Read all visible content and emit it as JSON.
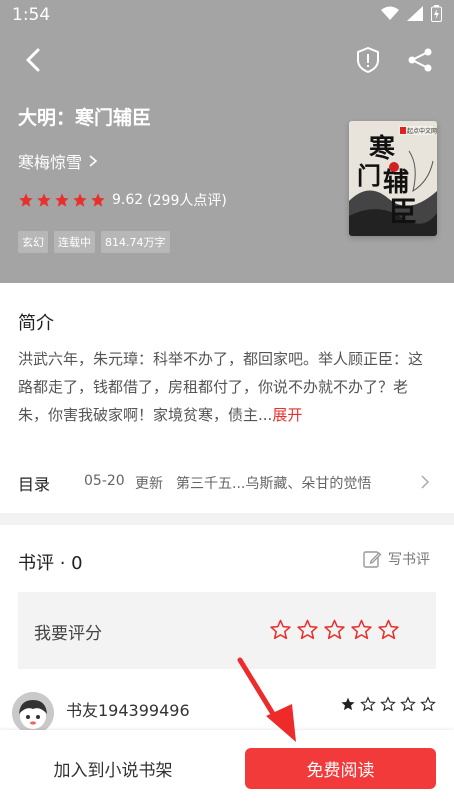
{
  "status": {
    "time": "1:54"
  },
  "book": {
    "title": "大明：寒门辅臣",
    "author": "寒梅惊雪",
    "rating": "9.62",
    "rating_count": "(299人点评)",
    "tags": [
      "玄幻",
      "连载中",
      "814.74万字"
    ],
    "cover": {
      "title_chars": "寒门辅臣",
      "publisher": "起点中文网"
    }
  },
  "intro": {
    "title": "简介",
    "text": "洪武六年，朱元璋：科举不办了，都回家吧。举人顾正臣：这路都走了，钱都借了，房租都付了，你说不办就不办了？老朱，你害我破家啊！家境贫寒，债主...",
    "expand_label": "展开"
  },
  "toc": {
    "label": "目录",
    "date": "05-20",
    "update_label": "更新",
    "chapter": "第三千五...乌斯藏、朵甘的觉悟"
  },
  "reviews": {
    "title": "书评 · 0",
    "write_label": "写书评",
    "rate_label": "我要评分",
    "items": [
      {
        "name": "书友194399496",
        "stars": 1
      }
    ]
  },
  "actions": {
    "shelf_label": "加入到小说书架",
    "read_label": "免费阅读"
  },
  "colors": {
    "accent": "#f23a3a",
    "header_bg": "#a4a4a4",
    "star_red": "#e8302c"
  }
}
